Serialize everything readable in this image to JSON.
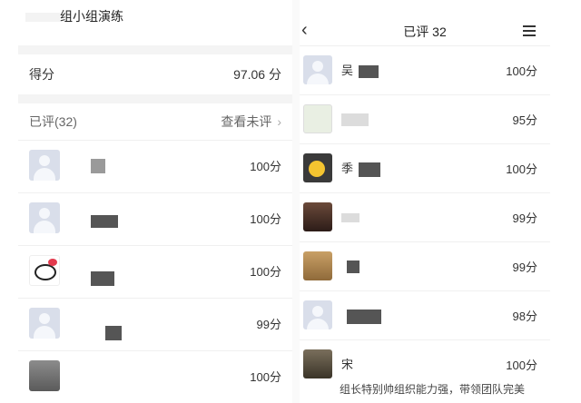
{
  "left": {
    "title": "组小组演练",
    "score_label": "得分",
    "score_value": "97.06 分",
    "rated_label": "已评(32)",
    "view_unrated": "查看未评",
    "rows": [
      {
        "avatar": "default-avatar",
        "score": "100分"
      },
      {
        "avatar": "default-avatar",
        "score": "100分"
      },
      {
        "avatar": "hello-kitty-avatar",
        "score": "100分"
      },
      {
        "avatar": "default-avatar",
        "score": "99分"
      },
      {
        "avatar": "husky-avatar",
        "score": "100分"
      }
    ]
  },
  "right": {
    "title": "已评 32",
    "rows": [
      {
        "avatar": "default-avatar",
        "name": "吴",
        "score": "100分"
      },
      {
        "avatar": "coin-avatar",
        "name": "",
        "score": "95分"
      },
      {
        "avatar": "emoji-avatar",
        "name": "季",
        "score": "100分"
      },
      {
        "avatar": "anime-avatar",
        "name": "",
        "score": "99分"
      },
      {
        "avatar": "fox-avatar",
        "name": "",
        "score": "99分"
      },
      {
        "avatar": "default-avatar",
        "name": "",
        "score": "98分"
      },
      {
        "avatar": "soldier-avatar",
        "name": "宋",
        "score": "100分"
      }
    ],
    "comment": "组长特别帅组织能力强，带领团队完美"
  },
  "icons": {
    "back": "chevron-left-icon",
    "menu": "hamburger-menu-icon",
    "more": "chevron-right-icon"
  }
}
